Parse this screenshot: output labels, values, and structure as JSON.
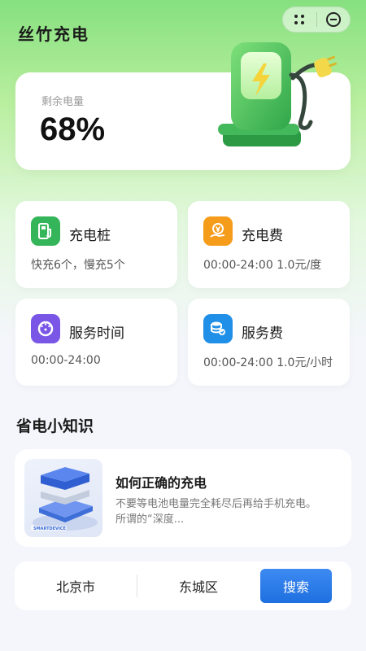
{
  "app": {
    "title": "丝竹充电"
  },
  "capsule": {
    "more_icon": "more-dots-icon",
    "close_icon": "close-circle-icon"
  },
  "battery": {
    "label": "剩余电量",
    "value": "68%",
    "level_fraction": 0.68
  },
  "tiles": [
    {
      "title": "充电桩",
      "desc": "快充6个，慢充5个",
      "icon": "charging-pile-icon",
      "color": "#34b55a"
    },
    {
      "title": "充电费",
      "desc": "00:00-24:00 1.0元/度",
      "icon": "yuan-hand-icon",
      "color": "#f59c1a"
    },
    {
      "title": "服务时间",
      "desc": "00:00-24:00",
      "icon": "clock-dial-icon",
      "color": "#7a56e6"
    },
    {
      "title": "服务费",
      "desc": "00:00-24:00 1.0元/小时",
      "icon": "coins-icon",
      "color": "#1f8fe8"
    }
  ],
  "tips": {
    "section_title": "省电小知识",
    "items": [
      {
        "title": "如何正确的充电",
        "body": "不要等电池电量完全耗尽后再给手机充电。 所谓的“深度...",
        "thumb_icon": "server-device-icon",
        "thumb_caption": "SMARTDEVICE"
      }
    ]
  },
  "search": {
    "city": "北京市",
    "district": "东城区",
    "button": "搜索"
  },
  "colors": {
    "accent_green": "#34b55a",
    "primary_blue": "#1e6fe0"
  }
}
